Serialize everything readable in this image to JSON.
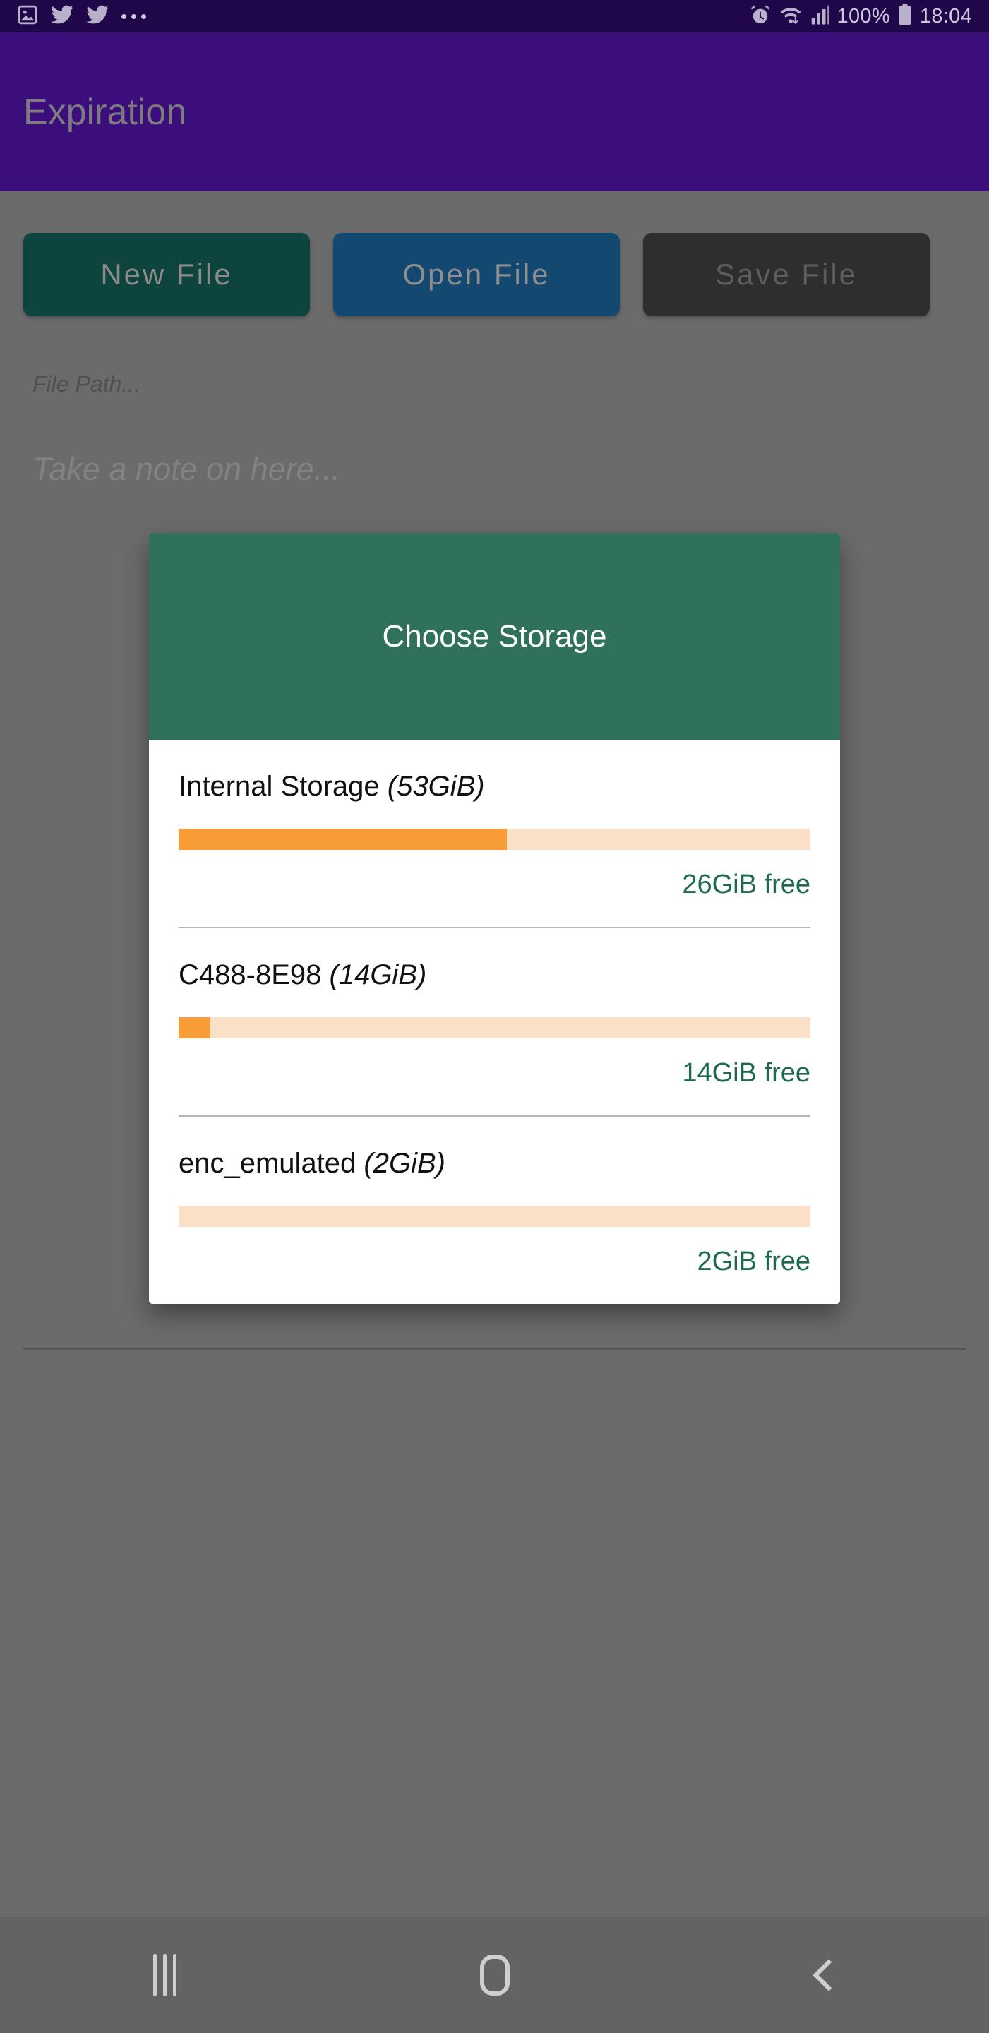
{
  "status_bar": {
    "left_icons": [
      "photo-icon",
      "twitter-icon",
      "twitter-icon",
      "overflow-dots-icon"
    ],
    "right_icons": [
      "alarm-icon",
      "wifi-icon",
      "signal-icon",
      "battery-icon"
    ],
    "battery_percent": "100%",
    "clock": "18:04",
    "background_color": "#20074a"
  },
  "app_bar": {
    "title": "Expiration",
    "background_color": "#3b0e7c"
  },
  "main": {
    "buttons": [
      {
        "label": "New File",
        "name": "new-file-button",
        "color": "#0d443d"
      },
      {
        "label": "Open File",
        "name": "open-file-button",
        "color": "#134970"
      },
      {
        "label": "Save File",
        "name": "save-file-button",
        "color": "#2e2e2e"
      }
    ],
    "file_path_placeholder": "File Path...",
    "file_path_value": "",
    "note_placeholder": "Take a note on here...",
    "note_value": ""
  },
  "dialog": {
    "title": "Choose Storage",
    "header_color": "#2f7159",
    "body_color": "#ffffff",
    "free_text_color": "#1e6a4e",
    "bar_fill_color": "#f79c36",
    "bar_track_color": "#fbe0c8",
    "items": [
      {
        "name": "Internal Storage",
        "capacity": "(53GiB)",
        "used_percent": 52,
        "free_label": "26GiB free"
      },
      {
        "name": "C488-8E98",
        "capacity": "(14GiB)",
        "used_percent": 5,
        "free_label": "14GiB free"
      },
      {
        "name": "enc_emulated",
        "capacity": "(2GiB)",
        "used_percent": 0,
        "free_label": "2GiB free"
      }
    ]
  },
  "nav_bar": {
    "items": [
      {
        "name": "recents-button",
        "icon": "recents-icon"
      },
      {
        "name": "home-button",
        "icon": "home-icon"
      },
      {
        "name": "back-button",
        "icon": "back-chevron-icon"
      }
    ]
  }
}
